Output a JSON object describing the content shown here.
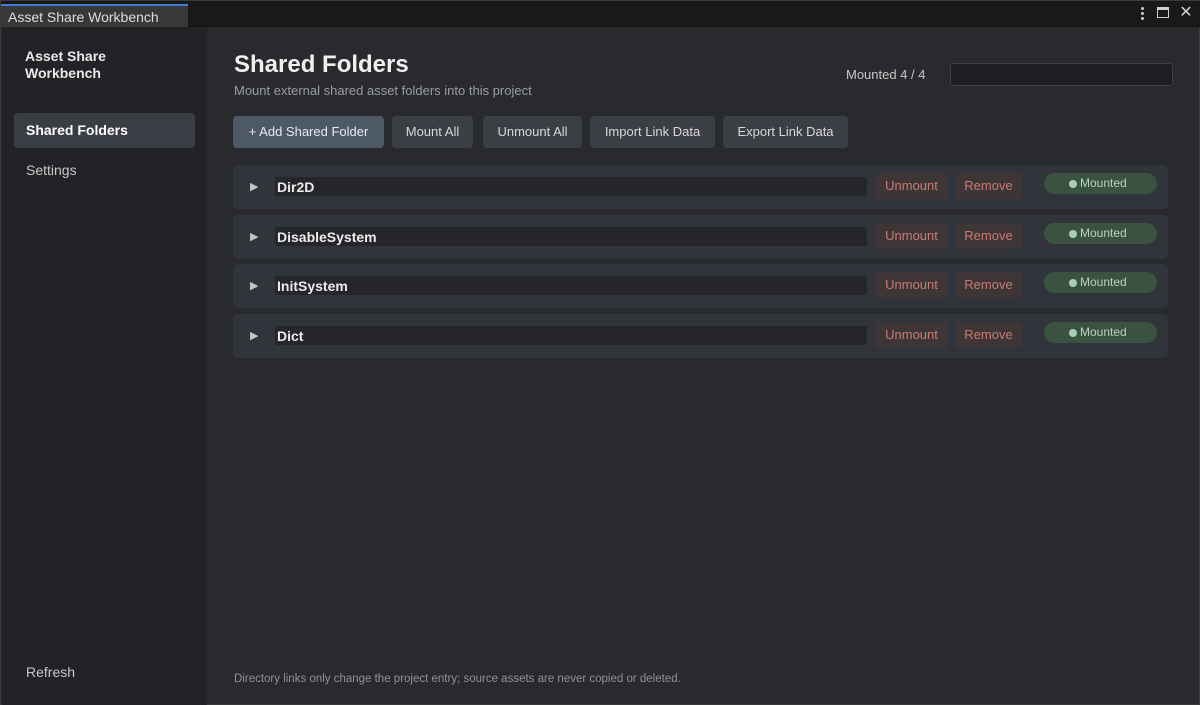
{
  "window": {
    "tab_title": "Asset Share Workbench"
  },
  "sidebar": {
    "brand": "Asset Share Workbench",
    "items": [
      {
        "label": "Shared Folders",
        "active": true
      },
      {
        "label": "Settings",
        "active": false
      }
    ],
    "refresh_label": "Refresh"
  },
  "main": {
    "title": "Shared Folders",
    "subtitle": "Mount external shared asset folders into this project",
    "mounted_count": "Mounted 4 / 4",
    "search": {
      "value": "",
      "placeholder": ""
    },
    "toolbar": {
      "add_label": "+ Add Shared Folder",
      "mount_all_label": "Mount All",
      "unmount_all_label": "Unmount All",
      "import_label": "Import Link Data",
      "export_label": "Export Link Data"
    },
    "folders": [
      {
        "name": "Dir2D",
        "unmount_label": "Unmount",
        "remove_label": "Remove",
        "status": "Mounted"
      },
      {
        "name": "DisableSystem",
        "unmount_label": "Unmount",
        "remove_label": "Remove",
        "status": "Mounted"
      },
      {
        "name": "InitSystem",
        "unmount_label": "Unmount",
        "remove_label": "Remove",
        "status": "Mounted"
      },
      {
        "name": "Dict",
        "unmount_label": "Unmount",
        "remove_label": "Remove",
        "status": "Mounted"
      }
    ],
    "footer_note": "Directory links only change the project entry; source assets are never copied or deleted."
  },
  "colors": {
    "accent_tab": "#3d7ed4",
    "primary_button": "#4d5966",
    "danger_text": "#c77b74",
    "status_badge": "#3a5240"
  }
}
